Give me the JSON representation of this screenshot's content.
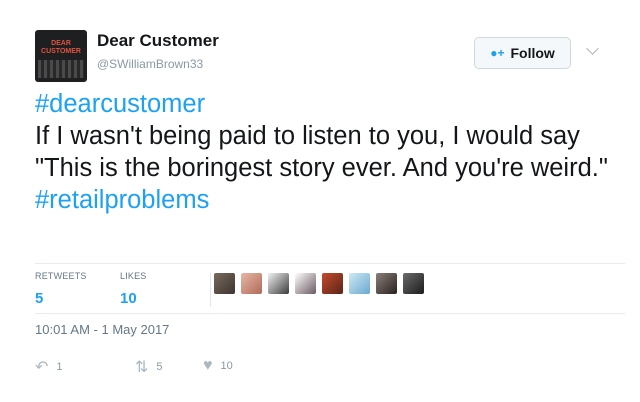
{
  "header": {
    "display_name": "Dear Customer",
    "handle": "@SWilliamBrown33",
    "follow_label": "Follow"
  },
  "tweet": {
    "hashtag1": "#dearcustomer",
    "text": "If I wasn't being paid to listen to you, I would say \"This is the boringest story ever. And you're weird.\"",
    "hashtag2": "#retailproblems"
  },
  "stats": {
    "retweets_label": "RETWEETS",
    "retweets_value": "5",
    "likes_label": "LIKES",
    "likes_value": "10"
  },
  "timestamp": "10:01 AM - 1 May 2017",
  "actions": {
    "reply_count": "1",
    "retweet_count": "5",
    "like_count": "10"
  },
  "colors": {
    "accent": "#1da1f2",
    "muted": "#657786",
    "like_heart": "#aab8c2"
  },
  "icons": {
    "follow": "add-user-icon",
    "menu": "chevron-down-icon",
    "reply": "reply-icon",
    "retweet": "retweet-icon",
    "like": "heart-icon"
  }
}
